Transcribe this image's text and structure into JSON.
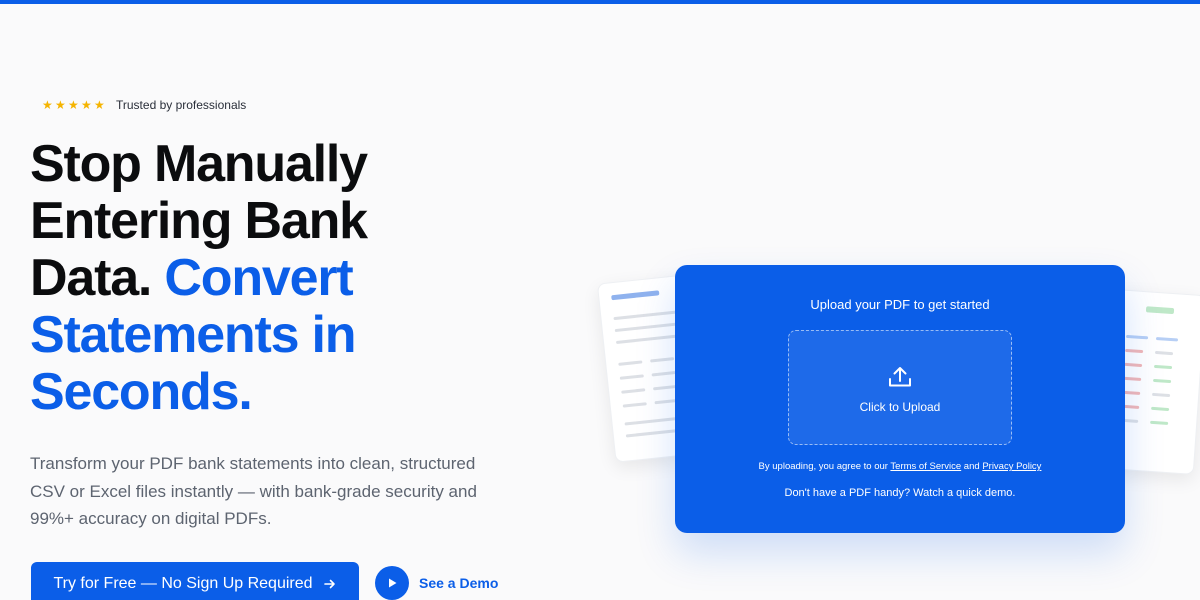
{
  "accent_color": "#0b5ee8",
  "hero": {
    "rating_stars": 5,
    "trust_text": "Trusted by professionals",
    "headline_plain": "Stop Manually Entering Bank Data. ",
    "headline_accent": "Convert Statements in Seconds.",
    "subtext": "Transform your PDF bank statements into clean, structured CSV or Excel files instantly — with bank-grade security and 99%+ accuracy on digital PDFs.",
    "cta_label": "Try for Free — No Sign Up Required",
    "cta_icon": "arrow-right-icon",
    "demo_label": "See a Demo",
    "demo_icon": "play-icon"
  },
  "upload": {
    "title": "Upload your PDF to get started",
    "icon": "upload-icon",
    "button_label": "Click to Upload",
    "legal_prefix": "By uploading, you agree to our ",
    "terms_link": "Terms of Service",
    "legal_and": " and ",
    "privacy_link": "Privacy Policy",
    "demo_note": "Don't have a PDF handy? Watch a quick demo."
  }
}
